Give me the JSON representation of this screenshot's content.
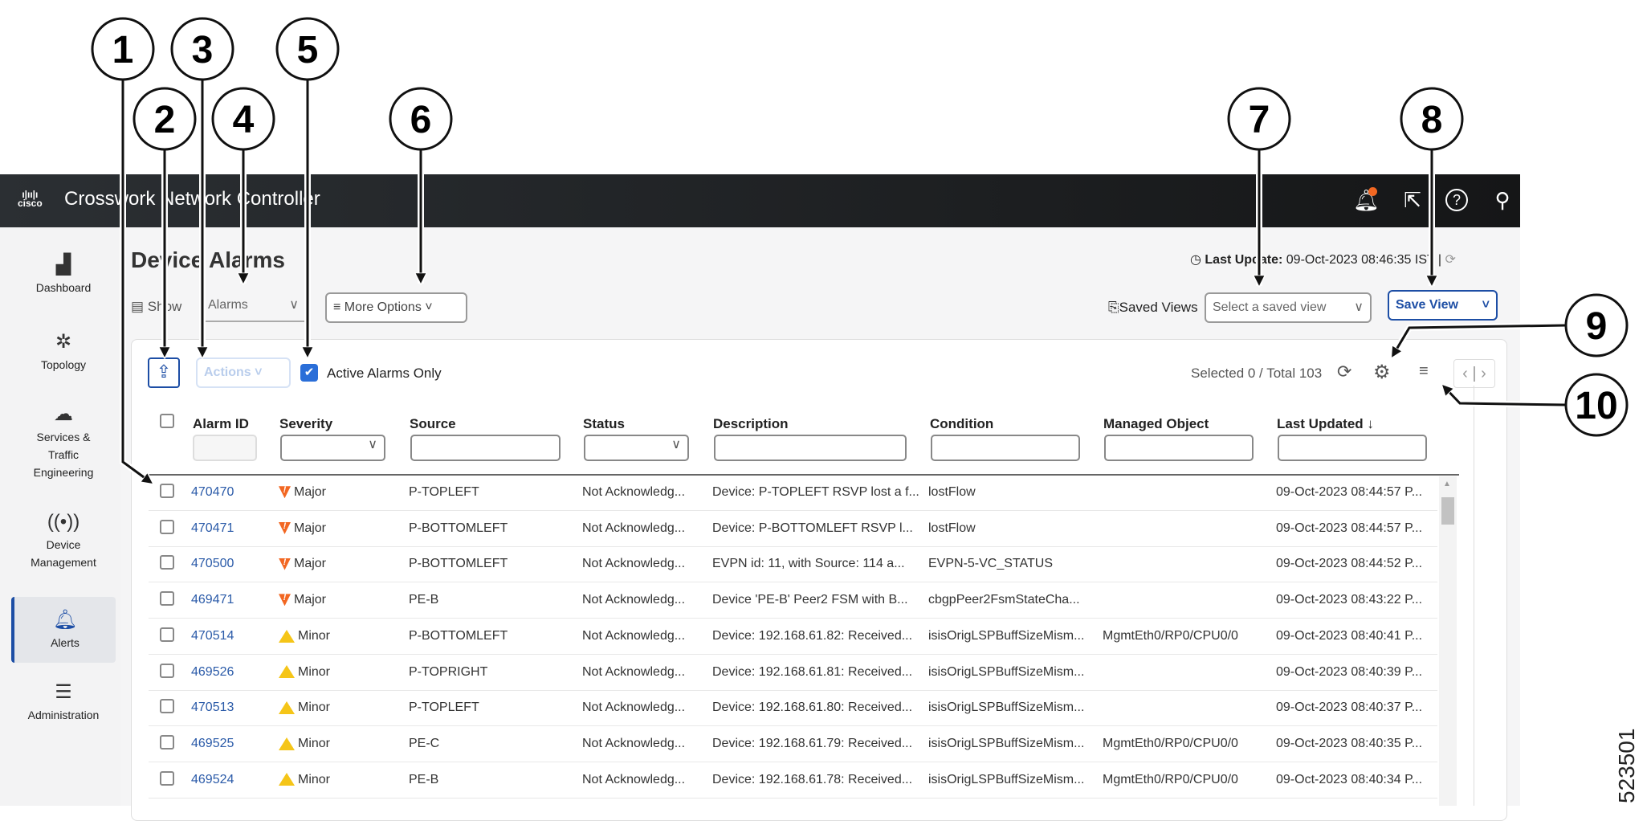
{
  "header": {
    "logo": "cisco",
    "title": "Crosswork Network Controller",
    "icons": [
      "bell-icon",
      "external-link-icon",
      "help-icon",
      "user-icon"
    ],
    "accent": "#f26722"
  },
  "sidebar": {
    "items": [
      {
        "label": "Dashboard",
        "icon": "dashboard-icon"
      },
      {
        "label": "Topology",
        "icon": "topology-icon"
      },
      {
        "label": "Services & Traffic Engineering",
        "icon": "services-icon"
      },
      {
        "label": "Device Management",
        "icon": "device-icon"
      },
      {
        "label": "Alerts",
        "icon": "bell-icon",
        "active": true
      },
      {
        "label": "Administration",
        "icon": "sliders-icon"
      }
    ]
  },
  "page": {
    "title": "Device Alarms",
    "last_update_label": "Last Update:",
    "last_update_value": "09-Oct-2023 08:46:35 IST",
    "show_label": "Show",
    "show_value": "Alarms",
    "more_options": "More Options",
    "saved_views_label": "Saved Views",
    "saved_view_placeholder": "Select a saved view",
    "save_view": "Save View"
  },
  "toolbar": {
    "actions": "Actions",
    "active_only": "Active Alarms Only",
    "selection": "Selected 0 / Total 103"
  },
  "table": {
    "columns": [
      "Alarm ID",
      "Severity",
      "Source",
      "Status",
      "Description",
      "Condition",
      "Managed Object",
      "Last Updated ↓"
    ],
    "rows": [
      [
        "470470",
        "Major",
        "P-TOPLEFT",
        "Not Acknowledg...",
        "Device: P-TOPLEFT RSVP lost a f...",
        "lostFlow",
        "",
        "09-Oct-2023 08:44:57 P..."
      ],
      [
        "470471",
        "Major",
        "P-BOTTOMLEFT",
        "Not Acknowledg...",
        "Device: P-BOTTOMLEFT RSVP l...",
        "lostFlow",
        "",
        "09-Oct-2023 08:44:57 P..."
      ],
      [
        "470500",
        "Major",
        "P-BOTTOMLEFT",
        "Not Acknowledg...",
        "EVPN id: 11, with Source: 114 a...",
        "EVPN-5-VC_STATUS",
        "",
        "09-Oct-2023 08:44:52 P..."
      ],
      [
        "469471",
        "Major",
        "PE-B",
        "Not Acknowledg...",
        "Device 'PE-B' Peer2 FSM with B...",
        "cbgpPeer2FsmStateCha...",
        "",
        "09-Oct-2023 08:43:22 P..."
      ],
      [
        "470514",
        "Minor",
        "P-BOTTOMLEFT",
        "Not Acknowledg...",
        "Device: 192.168.61.82: Received...",
        "isisOrigLSPBuffSizeMism...",
        "MgmtEth0/RP0/CPU0/0",
        "09-Oct-2023 08:40:41 P..."
      ],
      [
        "469526",
        "Minor",
        "P-TOPRIGHT",
        "Not Acknowledg...",
        "Device: 192.168.61.81: Received...",
        "isisOrigLSPBuffSizeMism...",
        "",
        "09-Oct-2023 08:40:39 P..."
      ],
      [
        "470513",
        "Minor",
        "P-TOPLEFT",
        "Not Acknowledg...",
        "Device: 192.168.61.80: Received...",
        "isisOrigLSPBuffSizeMism...",
        "",
        "09-Oct-2023 08:40:37 P..."
      ],
      [
        "469525",
        "Minor",
        "PE-C",
        "Not Acknowledg...",
        "Device: 192.168.61.79: Received...",
        "isisOrigLSPBuffSizeMism...",
        "MgmtEth0/RP0/CPU0/0",
        "09-Oct-2023 08:40:35 P..."
      ],
      [
        "469524",
        "Minor",
        "PE-B",
        "Not Acknowledg...",
        "Device: 192.168.61.78: Received...",
        "isisOrigLSPBuffSizeMism...",
        "MgmtEth0/RP0/CPU0/0",
        "09-Oct-2023 08:40:34 P..."
      ]
    ]
  },
  "callouts": [
    "1",
    "2",
    "3",
    "4",
    "5",
    "6",
    "7",
    "8",
    "9",
    "10"
  ],
  "figure_id": "523501"
}
